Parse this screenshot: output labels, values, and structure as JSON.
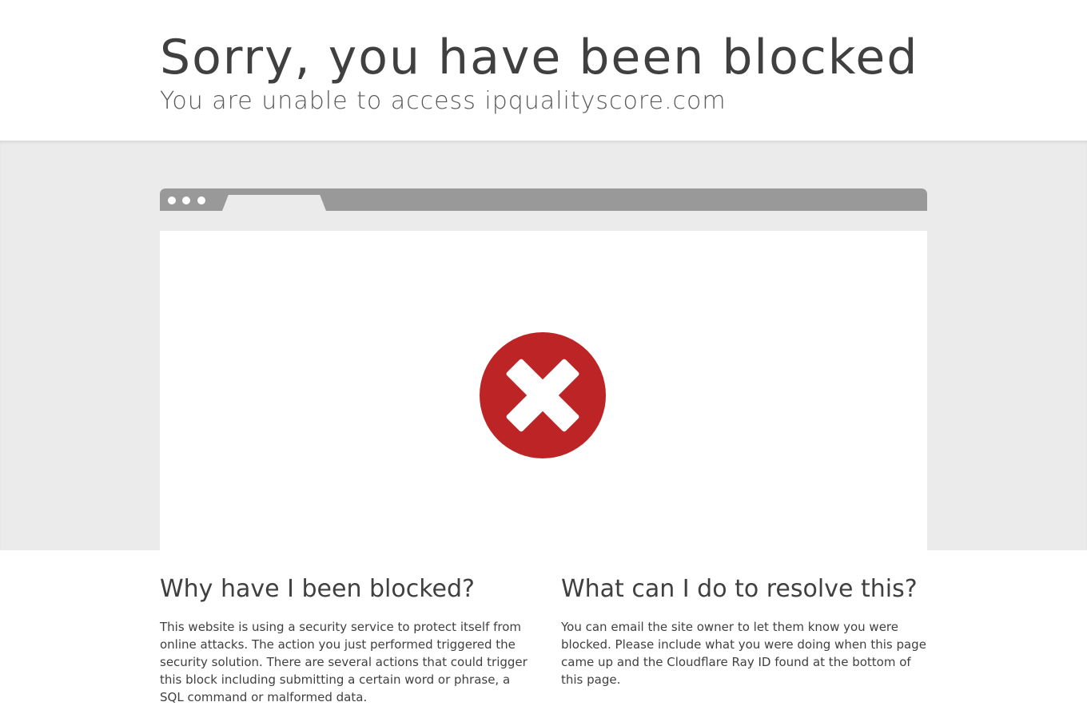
{
  "header": {
    "title": "Sorry, you have been blocked",
    "subtitle_prefix": "You are unable to access",
    "subtitle_domain": "ipqualityscore.com"
  },
  "browser": {
    "icon": "error-x-icon",
    "icon_color": "#bd2426"
  },
  "sections": {
    "why": {
      "heading": "Why have I been blocked?",
      "body": "This website is using a security service to protect itself from online attacks. The action you just performed triggered the security solution. There are several actions that could trigger this block including submitting a certain word or phrase, a SQL command or malformed data."
    },
    "resolve": {
      "heading": "What can I do to resolve this?",
      "body": "You can email the site owner to let them know you were blocked. Please include what you were doing when this page came up and the Cloudflare Ray ID found at the bottom of this page."
    }
  }
}
